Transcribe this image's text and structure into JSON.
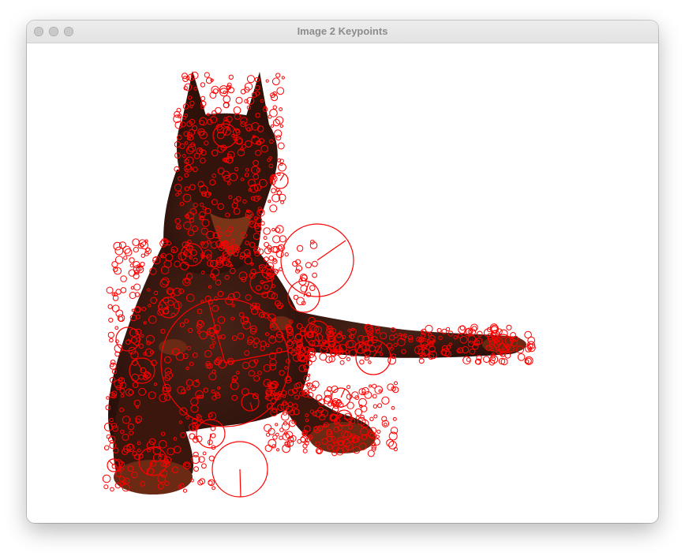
{
  "window": {
    "title": "Image 2 Keypoints",
    "controls": [
      "close",
      "minimize",
      "zoom"
    ]
  },
  "image": {
    "subject": "doberman-dog-photo",
    "keypoint_color": "#ff0000",
    "dog_color": "#3a1a12",
    "tan_color": "#8a3b1c"
  }
}
